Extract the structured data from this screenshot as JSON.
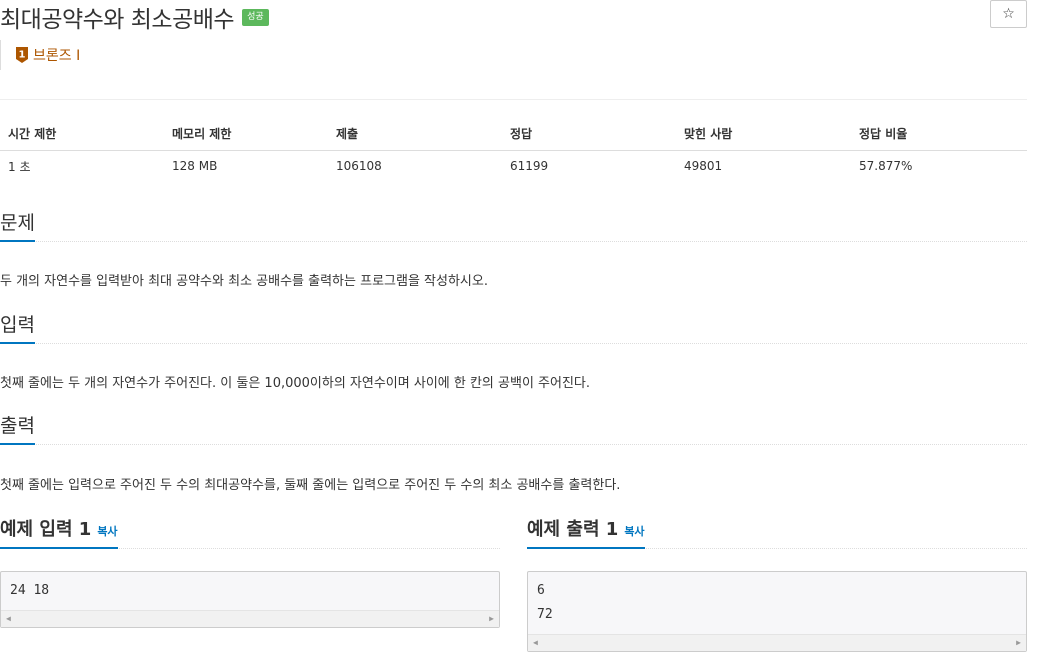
{
  "problem": {
    "title": "최대공약수와 최소공배수",
    "result_badge": "성공",
    "star_label": "☆",
    "tier": {
      "level": "1",
      "name": "브론즈 I",
      "color": "#ad5600"
    }
  },
  "info_table": {
    "headers": [
      "시간 제한",
      "메모리 제한",
      "제출",
      "정답",
      "맞힌 사람",
      "정답 비율"
    ],
    "values": [
      "1 초",
      "128 MB",
      "106108",
      "61199",
      "49801",
      "57.877%"
    ]
  },
  "sections": {
    "description": {
      "title": "문제",
      "text": "두 개의 자연수를 입력받아 최대 공약수와 최소 공배수를 출력하는 프로그램을 작성하시오."
    },
    "input": {
      "title": "입력",
      "text": "첫째 줄에는 두 개의 자연수가 주어진다. 이 둘은 10,000이하의 자연수이며 사이에 한 칸의 공백이 주어진다."
    },
    "output": {
      "title": "출력",
      "text": "첫째 줄에는 입력으로 주어진 두 수의 최대공약수를, 둘째 줄에는 입력으로 주어진 두 수의 최소 공배수를 출력한다."
    }
  },
  "samples": {
    "input": {
      "title": "예제 입력 1",
      "copy_label": "복사",
      "lines": [
        "24 18"
      ]
    },
    "output": {
      "title": "예제 출력 1",
      "copy_label": "복사",
      "lines": [
        "6",
        "72"
      ]
    }
  },
  "colors": {
    "accent": "#0076c0",
    "success": "#5cb85c"
  }
}
